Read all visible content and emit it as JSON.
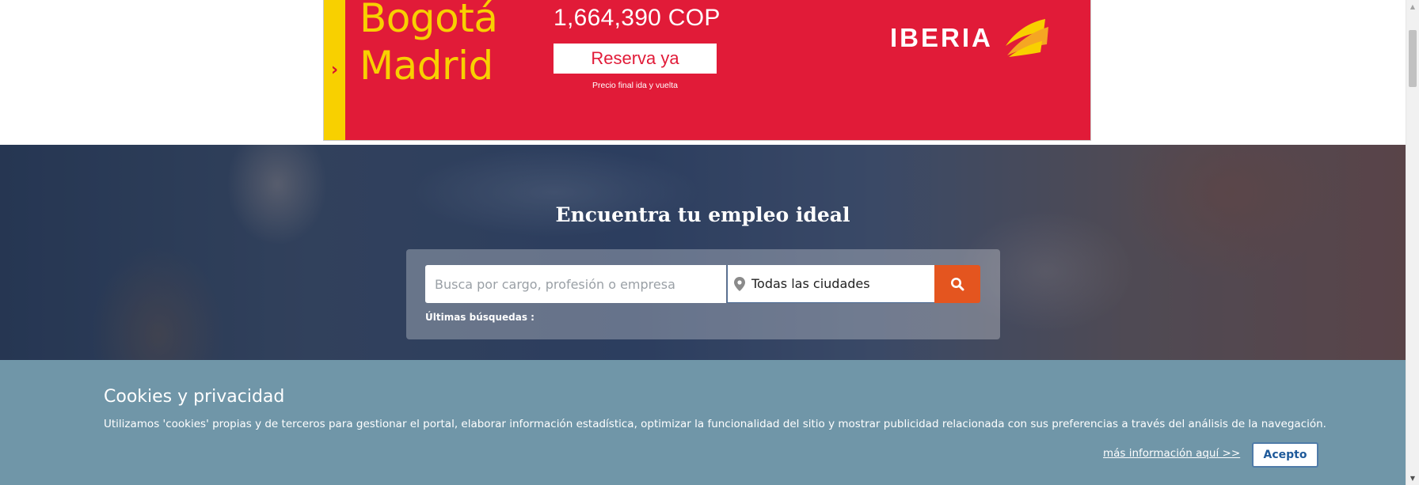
{
  "ad": {
    "arrow": "›",
    "city_from": "Bogotá",
    "city_to": "Madrid",
    "price": "1,664,390 COP",
    "cta": "Reserva ya",
    "note": "Precio final ida y vuelta",
    "brand": "IBERIA",
    "colors": {
      "background": "#e11b38",
      "accent": "#f8d000"
    }
  },
  "hero": {
    "title": "Encuentra tu empleo ideal",
    "search_placeholder": "Busca por cargo, profesión o empresa",
    "city_value": "Todas las ciudades",
    "search_button_icon": "search-icon",
    "recent_label": "Últimas búsquedas :"
  },
  "cookies": {
    "title": "Cookies y privacidad",
    "text": "Utilizamos 'cookies' propias y de terceros para gestionar el portal, elaborar información estadística, optimizar la funcionalidad del sitio y mostrar publicidad relacionada con sus preferencias a través del análisis de la navegación.",
    "more_link": "más información aquí >>",
    "accept": "Acepto",
    "colors": {
      "background": "#7096a8"
    }
  },
  "scrollbar": {
    "up_icon": "▲",
    "down_icon": "▼"
  }
}
